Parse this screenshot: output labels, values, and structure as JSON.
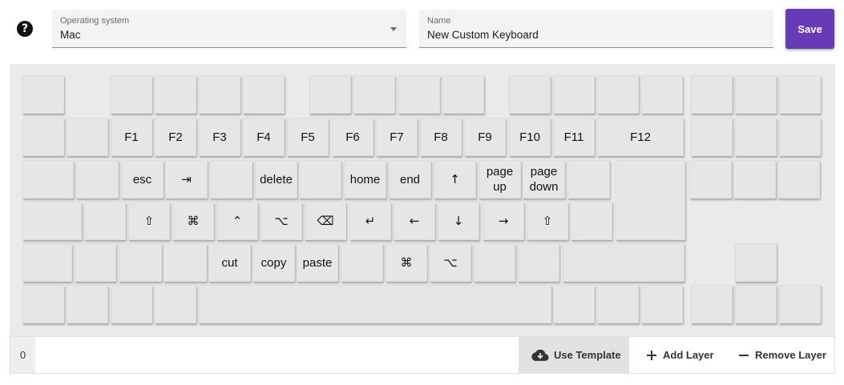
{
  "help": {
    "icon": "help-circle-icon",
    "glyph": "?"
  },
  "os_field": {
    "label": "Operating system",
    "value": "Mac"
  },
  "name_field": {
    "label": "Name",
    "value": "New Custom Keyboard"
  },
  "save_label": "Save",
  "accent_color": "#673ab7",
  "keys": [
    "",
    "",
    "",
    "",
    "",
    "",
    "",
    "",
    "",
    "",
    "",
    "",
    "",
    "",
    "",
    "",
    "",
    "",
    "F1",
    "F2",
    "F3",
    "F4",
    "F5",
    "F6",
    "F7",
    "F8",
    "F9",
    "F10",
    "F11",
    "F12",
    "",
    "",
    "",
    "",
    "",
    "esc",
    "⇥",
    "",
    "delete",
    "",
    "home",
    "end",
    "↑",
    "page\nup",
    "page\ndown",
    "",
    "",
    "",
    "",
    "",
    "",
    "",
    "⇧",
    "⌘",
    "⌃",
    "⌥",
    "⌫",
    "↵",
    "←",
    "↓",
    "→",
    "⇧",
    "",
    "",
    "",
    "",
    "",
    "cut",
    "copy",
    "paste",
    "",
    "⌘",
    "⌥",
    "",
    "",
    "",
    "",
    "",
    "",
    "",
    "",
    "",
    "",
    "",
    "",
    "",
    "",
    "",
    ""
  ],
  "layers": {
    "current": "0"
  },
  "actions": {
    "use_template": "Use Template",
    "add_layer": "Add Layer",
    "remove_layer": "Remove Layer"
  }
}
